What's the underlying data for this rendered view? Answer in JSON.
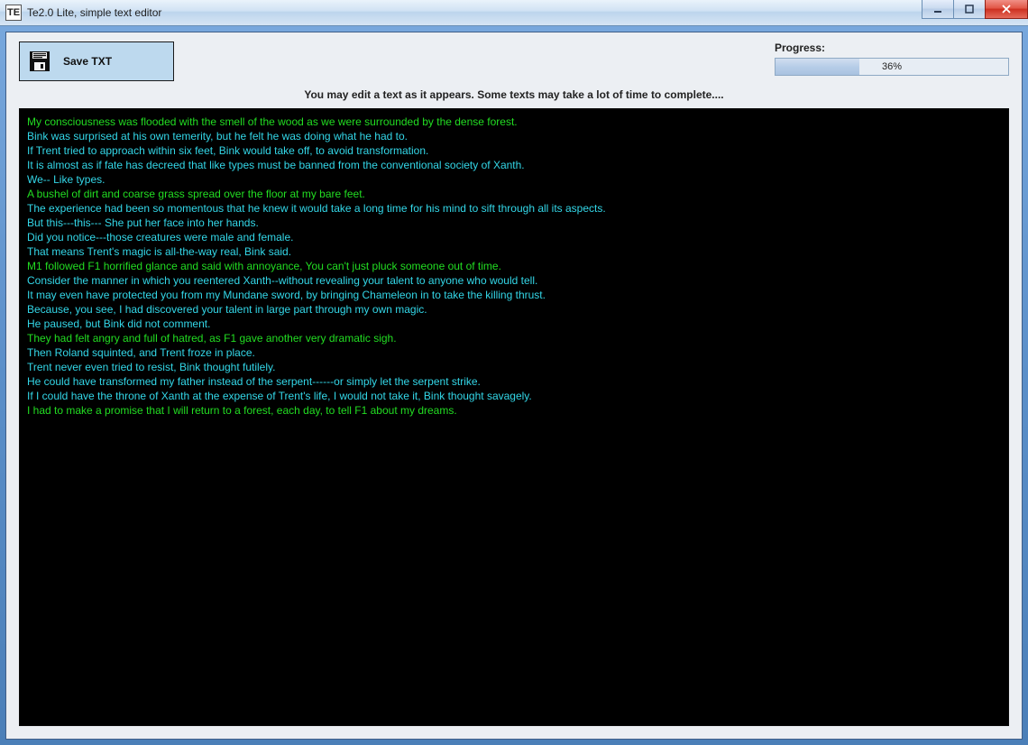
{
  "window": {
    "icon_text": "TE",
    "title": "Te2.0 Lite, simple text editor"
  },
  "toolbar": {
    "save_label": "Save TXT"
  },
  "progress": {
    "label": "Progress:",
    "percent": 36,
    "percent_text": "36%"
  },
  "instruction": "You may edit a text as it appears. Some texts may take a lot of time to complete....",
  "colors": {
    "green": "#22dd22",
    "cyan": "#33d7e8"
  },
  "editor_lines": [
    {
      "c": "green",
      "t": "My consciousness was flooded with the smell of the wood as we were surrounded by the dense forest."
    },
    {
      "c": "cyan",
      "t": "Bink was surprised at his own temerity, but he felt he was doing what he had to."
    },
    {
      "c": "cyan",
      "t": "If Trent tried to approach within six feet, Bink would take off, to avoid transformation."
    },
    {
      "c": "cyan",
      "t": "It is almost as if fate has decreed that like types must be banned from the conventional society of Xanth."
    },
    {
      "c": "cyan",
      "t": "We-- Like types."
    },
    {
      "c": "green",
      "t": "A bushel of dirt and coarse grass spread over the floor at my bare feet."
    },
    {
      "c": "cyan",
      "t": "The experience had been so momentous that he knew it would take a long time for his mind to sift through all its aspects."
    },
    {
      "c": "cyan",
      "t": "But this---this--- She put her face into her hands."
    },
    {
      "c": "cyan",
      "t": "Did you notice---those creatures were male and female."
    },
    {
      "c": "cyan",
      "t": "That means Trent's magic is all-the-way real, Bink said."
    },
    {
      "c": "green",
      "t": "M1 followed F1 horrified glance and said with annoyance, You can't just pluck someone out of time."
    },
    {
      "c": "cyan",
      "t": "Consider the manner in which you reentered Xanth--without revealing your talent to anyone who would tell."
    },
    {
      "c": "cyan",
      "t": "It may even have protected you from my Mundane sword, by bringing Chameleon in to take the killing thrust."
    },
    {
      "c": "cyan",
      "t": "Because, you see, I had discovered your talent in large part through my own magic."
    },
    {
      "c": "cyan",
      "t": "He paused, but Bink did not comment."
    },
    {
      "c": "green",
      "t": "They had felt angry and full of hatred, as F1 gave another very dramatic sigh."
    },
    {
      "c": "cyan",
      "t": "Then Roland squinted, and Trent froze in place."
    },
    {
      "c": "cyan",
      "t": "Trent never even tried to resist, Bink thought futilely."
    },
    {
      "c": "cyan",
      "t": "He could have transformed my father instead of the serpent------or simply let the serpent strike."
    },
    {
      "c": "cyan",
      "t": "If I could have the throne of Xanth at the expense of Trent's life, I would not take it, Bink thought savagely."
    },
    {
      "c": "green",
      "t": "I had to make a promise that I will return to a forest, each day, to tell F1 about my dreams."
    }
  ]
}
